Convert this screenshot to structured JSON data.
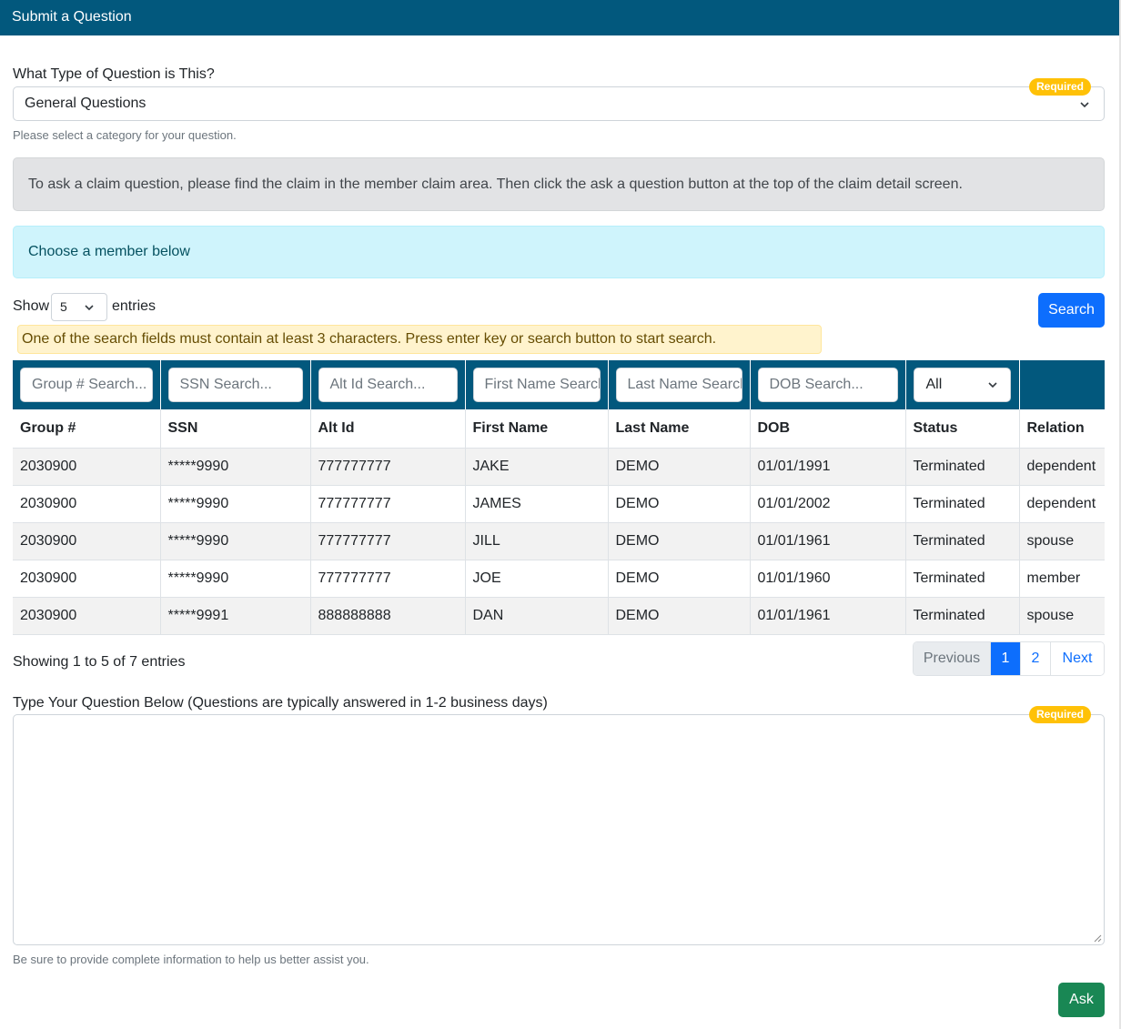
{
  "header": {
    "title": "Submit a Question"
  },
  "question_type": {
    "label": "What Type of Question is This?",
    "selected": "General Questions",
    "required_badge": "Required",
    "help": "Please select a category for your question."
  },
  "alerts": {
    "claim_note": "To ask a claim question, please find the claim in the member claim area. Then click the ask a question button at the top of the claim detail screen.",
    "choose_member": "Choose a member below"
  },
  "table_controls": {
    "show_label": "Show",
    "page_length": "5",
    "entries_label": "entries",
    "search_button": "Search",
    "search_warning": "One of the search fields must contain at least 3 characters. Press enter key or search button to start search."
  },
  "filters": {
    "group": "Group # Search...",
    "ssn": "SSN Search...",
    "alt_id": "Alt Id Search...",
    "first_name": "First Name Search...",
    "last_name": "Last Name Search...",
    "dob": "DOB Search...",
    "status": "All"
  },
  "columns": [
    "Group #",
    "SSN",
    "Alt Id",
    "First Name",
    "Last Name",
    "DOB",
    "Status",
    "Relation"
  ],
  "rows": [
    [
      "2030900",
      "*****9990",
      "777777777",
      "JAKE",
      "DEMO",
      "01/01/1991",
      "Terminated",
      "dependent"
    ],
    [
      "2030900",
      "*****9990",
      "777777777",
      "JAMES",
      "DEMO",
      "01/01/2002",
      "Terminated",
      "dependent"
    ],
    [
      "2030900",
      "*****9990",
      "777777777",
      "JILL",
      "DEMO",
      "01/01/1961",
      "Terminated",
      "spouse"
    ],
    [
      "2030900",
      "*****9990",
      "777777777",
      "JOE",
      "DEMO",
      "01/01/1960",
      "Terminated",
      "member"
    ],
    [
      "2030900",
      "*****9991",
      "888888888",
      "DAN",
      "DEMO",
      "01/01/1961",
      "Terminated",
      "spouse"
    ]
  ],
  "pagination": {
    "info": "Showing 1 to 5 of 7 entries",
    "previous": "Previous",
    "pages": [
      "1",
      "2"
    ],
    "next": "Next"
  },
  "question_text": {
    "label": "Type Your Question Below (Questions are typically answered in 1-2 business days)",
    "required_badge": "Required",
    "value": "",
    "help": "Be sure to provide complete information to help us better assist you."
  },
  "ask_button": "Ask",
  "colors": {
    "header": "#02587d",
    "primary": "#0d6efd",
    "success": "#198754",
    "warning_badge": "#ffc107"
  }
}
